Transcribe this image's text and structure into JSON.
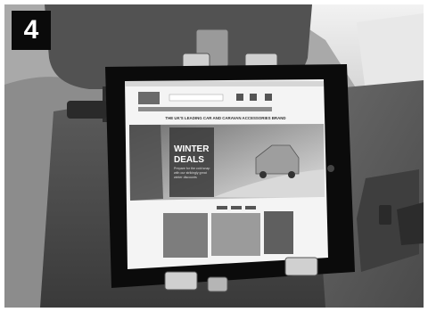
{
  "step": {
    "number": "4"
  },
  "website": {
    "headline": "THE UK'S LEADING CAR AND CARAVAN ACCESSORIES BRAND",
    "hero_title_line1": "WINTER",
    "hero_title_line2": "DEALS",
    "hero_text_line1": "Prepare for the cold snap",
    "hero_text_line2": "with our strikingly great",
    "hero_text_line3": "winter discounts"
  }
}
